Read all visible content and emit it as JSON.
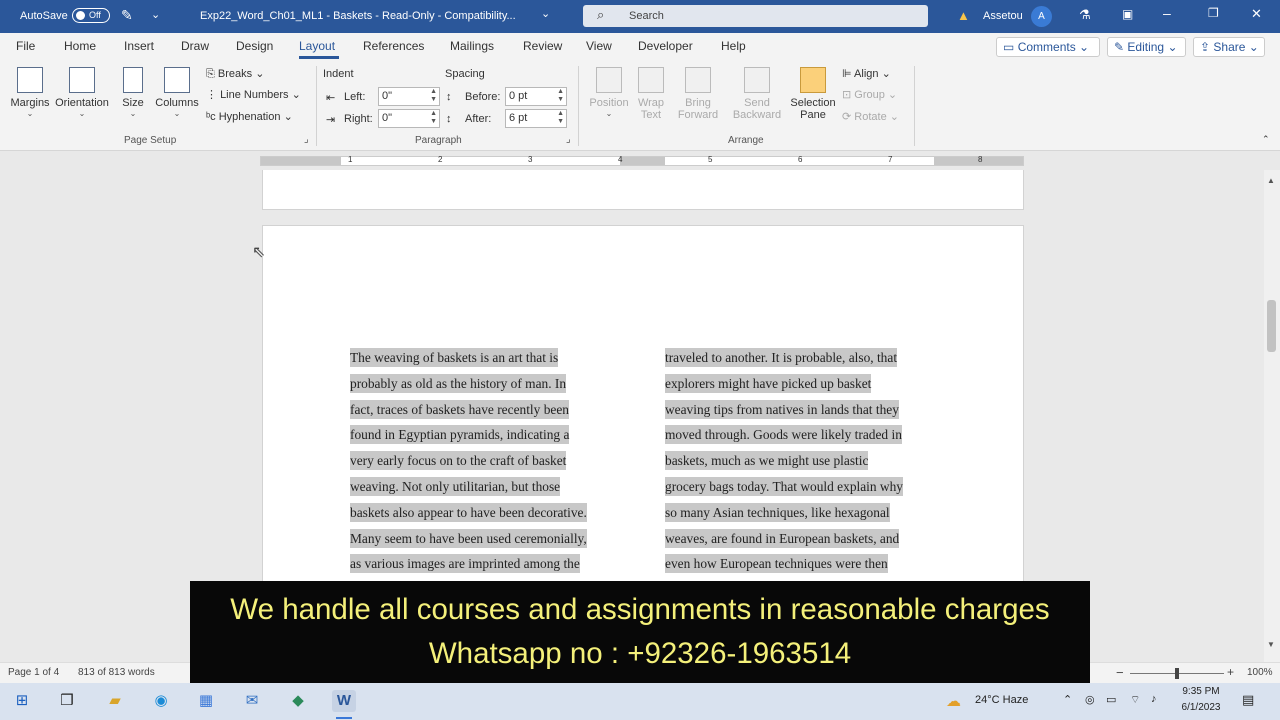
{
  "titlebar": {
    "autosave_label": "AutoSave",
    "autosave_state": "Off",
    "doc_title": "Exp22_Word_Ch01_ML1 - Baskets - Read-Only - Compatibility...",
    "search_placeholder": "Search",
    "user_name": "Assetou",
    "avatar_initial": "A"
  },
  "menu": {
    "tabs": [
      "File",
      "Home",
      "Insert",
      "Draw",
      "Design",
      "Layout",
      "References",
      "Mailings",
      "Review",
      "View",
      "Developer",
      "Help"
    ],
    "active_tab": "Layout",
    "comments_label": "Comments",
    "editing_label": "Editing",
    "share_label": "Share"
  },
  "ribbon": {
    "page_setup": {
      "margins": "Margins",
      "orientation": "Orientation",
      "size": "Size",
      "columns": "Columns",
      "breaks": "Breaks",
      "line_numbers": "Line Numbers",
      "hyphenation": "Hyphenation",
      "group_label": "Page Setup"
    },
    "paragraph": {
      "indent_label": "Indent",
      "spacing_label": "Spacing",
      "left_label": "Left:",
      "left_value": "0\"",
      "right_label": "Right:",
      "right_value": "0\"",
      "before_label": "Before:",
      "before_value": "0 pt",
      "after_label": "After:",
      "after_value": "6 pt",
      "group_label": "Paragraph"
    },
    "arrange": {
      "position": "Position",
      "wrap_text_1": "Wrap",
      "wrap_text_2": "Text",
      "bring_forward_1": "Bring",
      "bring_forward_2": "Forward",
      "send_backward_1": "Send",
      "send_backward_2": "Backward",
      "selection_pane_1": "Selection",
      "selection_pane_2": "Pane",
      "align": "Align",
      "group": "Group",
      "rotate": "Rotate",
      "group_label": "Arrange"
    }
  },
  "ruler": {
    "numbers": [
      "1",
      "2",
      "3",
      "4",
      "5",
      "6",
      "7",
      "8"
    ],
    "tab_selector": "L"
  },
  "document": {
    "column_left": [
      "The weaving of baskets is an art that is",
      "probably as old as the history of man. In",
      "fact, traces of baskets have recently been",
      "found in Egyptian pyramids, indicating a",
      "very early focus on to the craft of basket",
      "weaving. Not only utilitarian, but those",
      "baskets also appear to have been decorative.",
      "Many seem to have been used ceremonially,",
      "as various images are imprinted among the"
    ],
    "column_right": [
      "traveled to another. It is probable, also, that",
      "explorers might have picked up basket",
      "weaving tips from natives in lands that they",
      "moved through. Goods were likely traded in",
      "baskets, much as we might use plastic",
      "grocery bags today. That would explain why",
      "so many Asian techniques, like hexagonal",
      "weaves, are found in European baskets, and",
      "even how European techniques were then"
    ]
  },
  "status": {
    "page": "Page 1 of 4",
    "words": "813 of 813 words",
    "zoom": "100%",
    "zoom_minus": "−",
    "zoom_plus": "+"
  },
  "overlay": {
    "line1": "We handle all courses and assignments in reasonable charges",
    "line2": "Whatsapp no : +92326-1963514"
  },
  "taskbar": {
    "weather": "24°C  Haze",
    "time": "9:35 PM",
    "date": "6/1/2023"
  }
}
